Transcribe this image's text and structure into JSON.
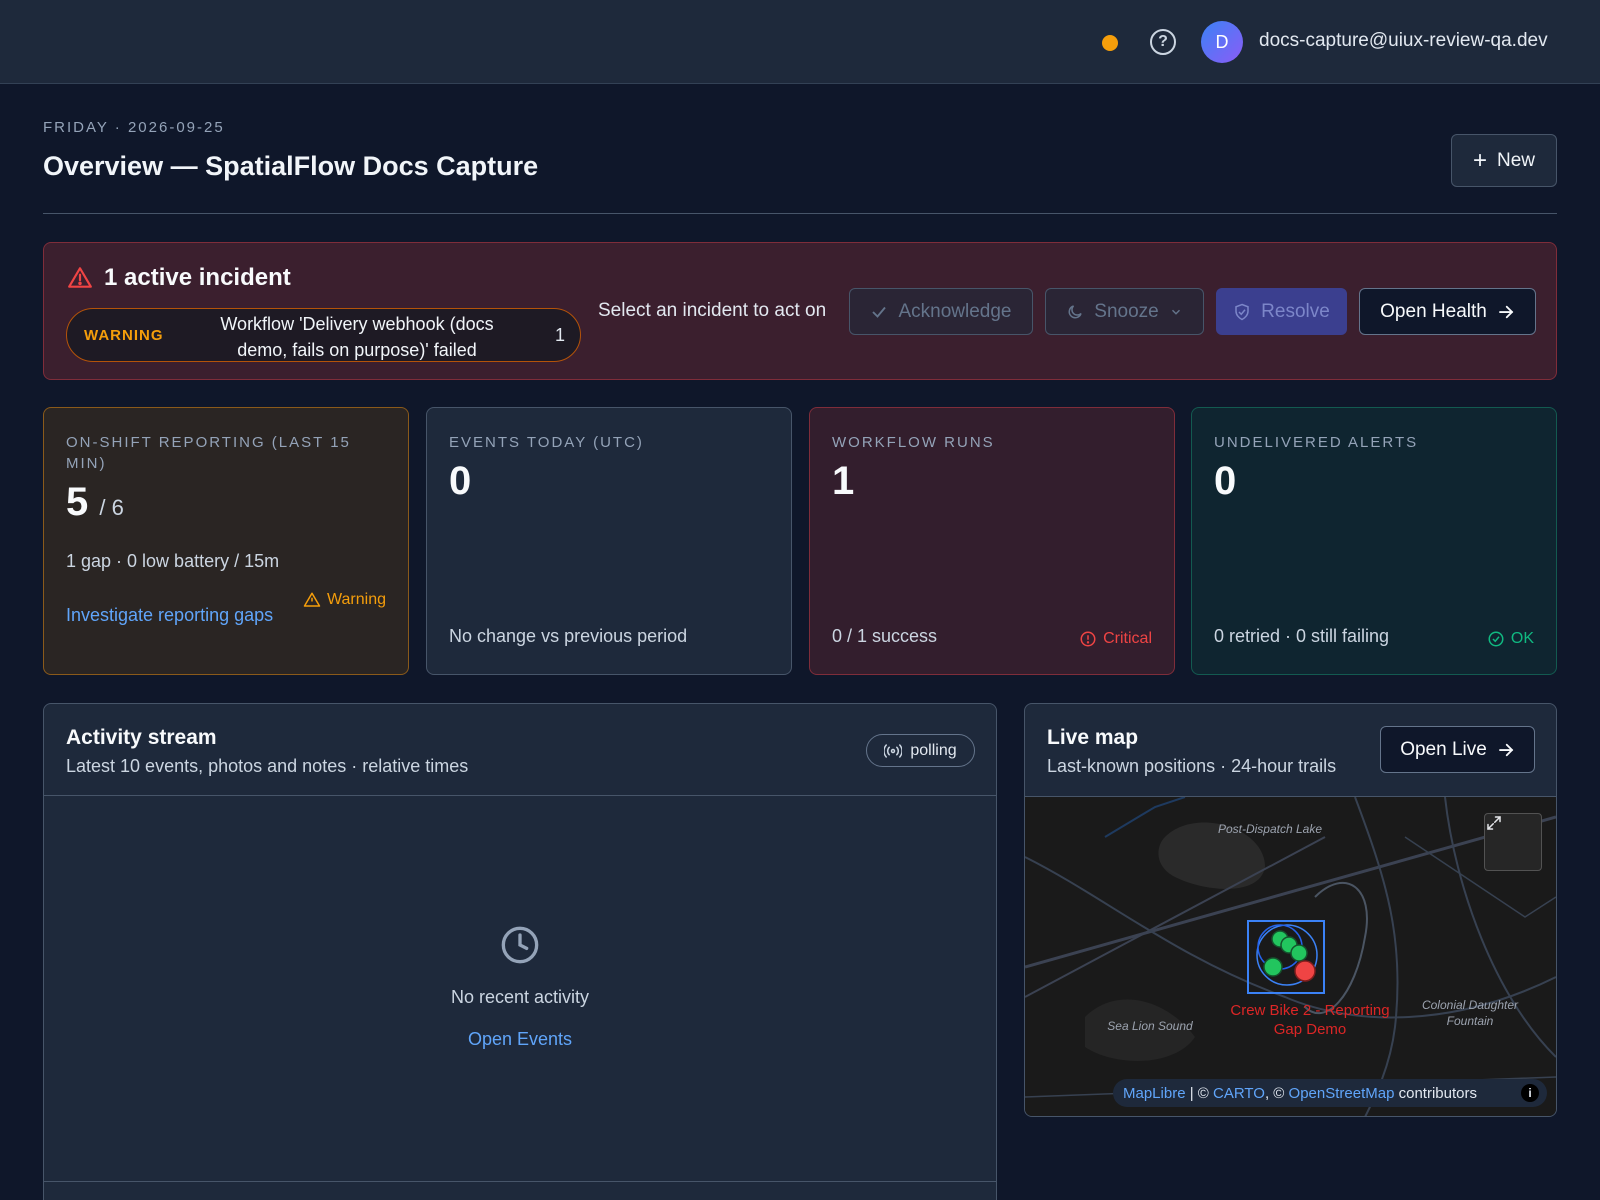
{
  "topbar": {
    "status_color": "#f59e0b",
    "help_icon": "question-circle-icon",
    "avatar_initial": "D",
    "user_email": "docs-capture@uiux-review-qa.dev"
  },
  "header": {
    "date_line": "FRIDAY · 2026-09-25",
    "title": "Overview — SpatialFlow Docs Capture",
    "new_button": "New"
  },
  "incident": {
    "title": "1 active incident",
    "severity": "WARNING",
    "message": "Workflow 'Delivery webhook (docs demo, fails on purpose)' failed",
    "count": "1",
    "prompt": "Select an incident to act on",
    "acknowledge": "Acknowledge",
    "snooze": "Snooze",
    "resolve": "Resolve",
    "open_health": "Open Health"
  },
  "cards": {
    "reporting": {
      "label": "ON-SHIFT REPORTING (LAST 15 MIN)",
      "value": "5",
      "denominator": "/ 6",
      "detail": "1 gap · 0 low battery / 15m",
      "link": "Investigate reporting gaps",
      "status": "Warning",
      "status_color": "#f59e0b"
    },
    "events": {
      "label": "EVENTS TODAY (UTC)",
      "value": "0",
      "footer": "No change vs previous period"
    },
    "workflows": {
      "label": "WORKFLOW RUNS",
      "value": "1",
      "footer": "0 / 1 success",
      "status": "Critical",
      "status_color": "#ef4444"
    },
    "alerts": {
      "label": "UNDELIVERED ALERTS",
      "value": "0",
      "footer": "0 retried · 0 still failing",
      "status": "OK",
      "status_color": "#10b981"
    }
  },
  "activity": {
    "title": "Activity stream",
    "subtitle": "Latest 10 events, photos and notes · relative times",
    "polling": "polling",
    "empty_text": "No recent activity",
    "open_events": "Open Events"
  },
  "live_map": {
    "title": "Live map",
    "subtitle": "Last-known positions · 24-hour trails",
    "open_live": "Open Live",
    "labels": {
      "lake": "Post-Dispatch Lake",
      "sound": "Sea Lion Sound",
      "fountain": "Colonial Daughter Fountain",
      "crew": "Crew Bike 2 - Reporting Gap Demo"
    },
    "attribution": {
      "maplibre": "MapLibre",
      "sep1": " | © ",
      "carto": "CARTO",
      "sep2": ", © ",
      "osm": "OpenStreetMap",
      "suffix": " contributors"
    }
  }
}
